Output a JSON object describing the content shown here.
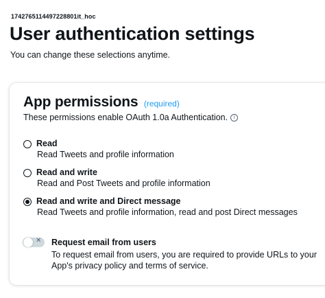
{
  "app": {
    "name": "1742765114497228801it_hoc"
  },
  "header": {
    "title": "User authentication settings",
    "subtitle": "You can change these selections anytime."
  },
  "permissions": {
    "title": "App permissions",
    "required_tag": "(required)",
    "description": "These permissions enable OAuth 1.0a Authentication.",
    "info_icon": "info-icon",
    "options": [
      {
        "label": "Read",
        "description": "Read Tweets and profile information",
        "selected": false
      },
      {
        "label": "Read and write",
        "description": "Read and Post Tweets and profile information",
        "selected": false
      },
      {
        "label": "Read and write and Direct message",
        "description": "Read Tweets and profile information, read and post Direct messages",
        "selected": true
      }
    ]
  },
  "email_request": {
    "toggle_state": "off",
    "label": "Request email from users",
    "description": "To request email from users, you are required to provide URLs to your App's privacy policy and terms of service."
  },
  "colors": {
    "accent": "#1d9bf0",
    "text": "#0f1419",
    "toggle_off": "#cfd9de"
  }
}
